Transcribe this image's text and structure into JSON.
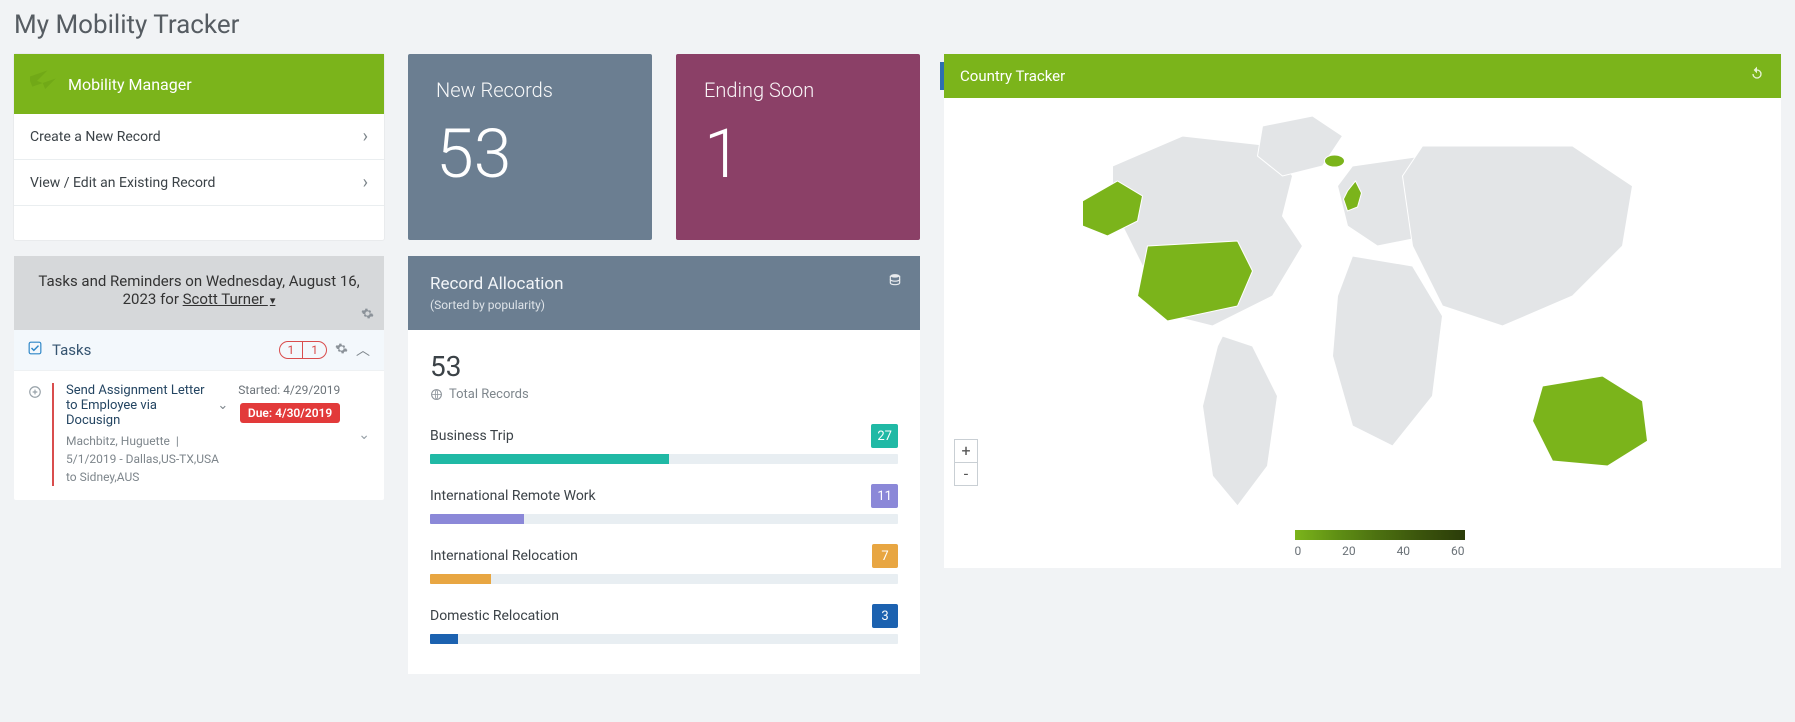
{
  "page_title": "My Mobility Tracker",
  "mobility_manager": {
    "title": "Mobility Manager",
    "links": [
      {
        "label": "Create a New Record"
      },
      {
        "label": "View / Edit an Existing Record"
      }
    ]
  },
  "tiles": {
    "new_records": {
      "label": "New Records",
      "value": "53"
    },
    "ending_soon": {
      "label": "Ending Soon",
      "value": "1"
    }
  },
  "country_tracker": {
    "title": "Country Tracker",
    "legend_ticks": [
      "0",
      "20",
      "40",
      "60"
    ],
    "highlighted": [
      "United States",
      "United Kingdom",
      "Iceland",
      "Australia"
    ]
  },
  "tasks": {
    "header_prefix": "Tasks and Reminders on Wednesday, August 16, 2023 for ",
    "user": "Scott Turner ",
    "section_label": "Tasks",
    "count_a": "1",
    "count_b": "1",
    "items": [
      {
        "title": "Send Assignment Letter to Employee via Docusign",
        "person": "Machbitz, Huguette",
        "details": "5/1/2019 - Dallas,US-TX,USA to Sidney,AUS",
        "started": "Started: 4/29/2019",
        "due": "Due: 4/30/2019"
      }
    ]
  },
  "allocation": {
    "title": "Record Allocation",
    "subtitle": "(Sorted by popularity)",
    "total_value": "53",
    "total_label": "Total Records",
    "items": [
      {
        "label": "Business Trip",
        "count": "27",
        "color": "#20b9a5",
        "pct": 51
      },
      {
        "label": "International Remote Work",
        "count": "11",
        "color": "#8b88d8",
        "pct": 20
      },
      {
        "label": "International Relocation",
        "count": "7",
        "color": "#e8a642",
        "pct": 13
      },
      {
        "label": "Domestic Relocation",
        "count": "3",
        "color": "#1c62b0",
        "pct": 6
      }
    ]
  },
  "chart_data": [
    {
      "type": "bar",
      "title": "Record Allocation",
      "categories": [
        "Business Trip",
        "International Remote Work",
        "International Relocation",
        "Domestic Relocation"
      ],
      "values": [
        27,
        11,
        7,
        3
      ],
      "ylim": [
        0,
        53
      ]
    },
    {
      "type": "heatmap",
      "title": "Country Tracker",
      "notes": "World choropleth; highlighted countries shaded green on 0–60 scale",
      "categories": [
        "United States",
        "United Kingdom",
        "Iceland",
        "Australia"
      ],
      "value_range": [
        0,
        60
      ]
    }
  ]
}
